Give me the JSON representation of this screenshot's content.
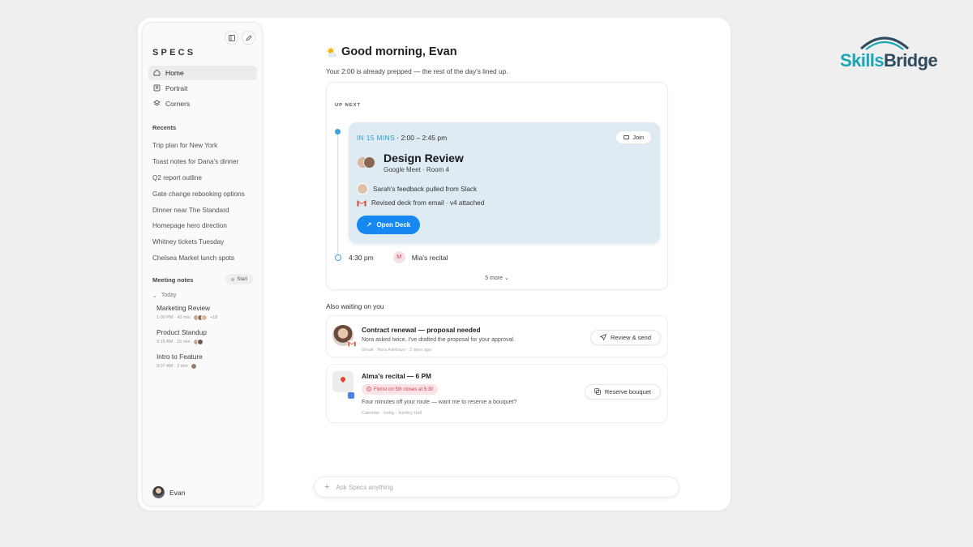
{
  "brand": {
    "part1": "Skills",
    "part2": "Bridge"
  },
  "sidebar": {
    "logo": "SPECS",
    "nav": [
      {
        "label": "Home",
        "icon": "home-icon"
      },
      {
        "label": "Portrait",
        "icon": "portrait-icon"
      },
      {
        "label": "Corners",
        "icon": "layers-icon"
      }
    ],
    "recents_label": "Recents",
    "recents": [
      "Trip plan for New York",
      "Toast notes for Dana's dinner",
      "Q2 report outline",
      "Gate change rebooking options",
      "Dinner near The Standard",
      "Homepage hero direction",
      "Whitney tickets Tuesday",
      "Chelsea Market lunch spots"
    ],
    "meeting_notes_label": "Meeting notes",
    "start_label": "Start",
    "today_label": "Today",
    "meeting_notes": [
      {
        "title": "Marketing Review",
        "meta": "1:00 PM · 42 min",
        "extra": "+18"
      },
      {
        "title": "Product Standup",
        "meta": "9:15 AM · 15 min",
        "extra": ""
      },
      {
        "title": "Intro to Feature",
        "meta": "9:07 AM · 2 min",
        "extra": ""
      }
    ],
    "user_name": "Evan"
  },
  "main": {
    "greeting": "Good morning, Evan",
    "subtitle": "Your 2:00 is already prepped — the rest of the day's lined up.",
    "up_next_label": "UP NEXT",
    "event": {
      "soon": "IN 15 MINS",
      "time": " · 2:00 – 2:45 pm",
      "join_label": "Join",
      "title": "Design Review",
      "location": "Google Meet · Room 4",
      "detail1": "Sarah's feedback pulled from Slack",
      "detail2": "Revised deck from email · v4 attached",
      "open_label": "Open Deck"
    },
    "next_event": {
      "time": "4:30 pm",
      "avatar": "M",
      "title": "Mia's recital"
    },
    "more_label": "5 more",
    "waiting_label": "Also waiting on you",
    "waiting": [
      {
        "title": "Contract renewal — proposal needed",
        "desc": "Nora asked twice. I've drafted the proposal for your approval.",
        "meta": "Gmail · Nora Adebayo · 2 days ago",
        "button": "Review & send"
      },
      {
        "title": "Alma's recital — 6 PM",
        "tag": "Florist on 5th closes at 5:30",
        "desc": "Four minutes off your route — want me to reserve a bouquet?",
        "meta": "Calendar · today · Hartley Hall",
        "button": "Reserve bouquet"
      }
    ],
    "ask_placeholder": "Ask Specs anything"
  }
}
